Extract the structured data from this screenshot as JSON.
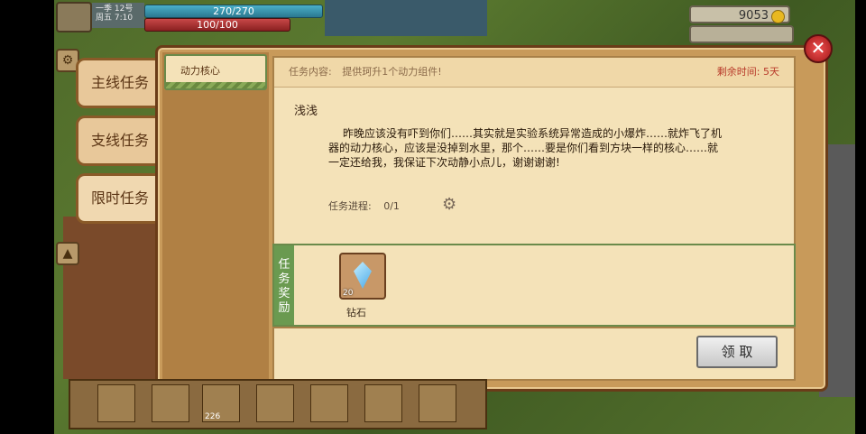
{
  "hud": {
    "season": "一季 12号",
    "weekday": "周五 7:10",
    "hp_text": "270/270",
    "energy_text": "100/100",
    "coins": "9053",
    "hotbar_count_1": "226"
  },
  "tabs": [
    {
      "label": "主线任务"
    },
    {
      "label": "支线任务"
    },
    {
      "label": "限时任务"
    }
  ],
  "quest_list": [
    {
      "label": "动力核心"
    }
  ],
  "quest": {
    "content_label": "任务内容:",
    "content_text": "提供珂升1个动力组件!",
    "time_label": "剩余时间: 5天",
    "npc_name": "浅浅",
    "dialog": "昨晚应该没有吓到你们……其实就是实验系统异常造成的小爆炸……就炸飞了机器的动力核心，应该是没掉到水里，那个……要是你们看到方块一样的核心……就一定还给我，我保证下次动静小点儿，谢谢谢谢!",
    "progress_label": "任务进程:",
    "progress_value": "0/1"
  },
  "reward": {
    "section_label": "任务奖励",
    "items": [
      {
        "name": "钻石",
        "qty": "20",
        "icon": "diamond-icon"
      }
    ]
  },
  "claim_label": "领 取"
}
